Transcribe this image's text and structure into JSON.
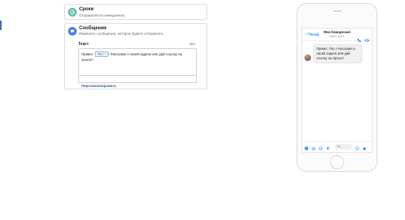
{
  "deadline_step": {
    "title": "Сроки",
    "subtitle": "Отправляется немедленно",
    "icon": "clock-icon",
    "color": "#5fbfa9"
  },
  "message_step": {
    "title": "Сообщения",
    "subtitle": "Измените сообщение, которое будете отправлять.",
    "icon": "chat-icon",
    "color": "#4e83d8",
    "field_label": "Текст",
    "char_count": "421",
    "text_prefix": "Привет,",
    "token_label": "Пол",
    "token_close": "×",
    "text_suffix": "! Расскажи о своей задаче или дай ссылку на проект!",
    "personalize_label": "Персонализировать"
  },
  "preview": {
    "back_label": "Назад",
    "contact_name": "Яна Кинарская",
    "contact_status": "Activo ahora",
    "bubble_text": "Привет, Пол ! Расскажи о своей задаче или дай ссылку на проект!",
    "composer_placeholder": "Aa",
    "accent": "#0084ff"
  }
}
